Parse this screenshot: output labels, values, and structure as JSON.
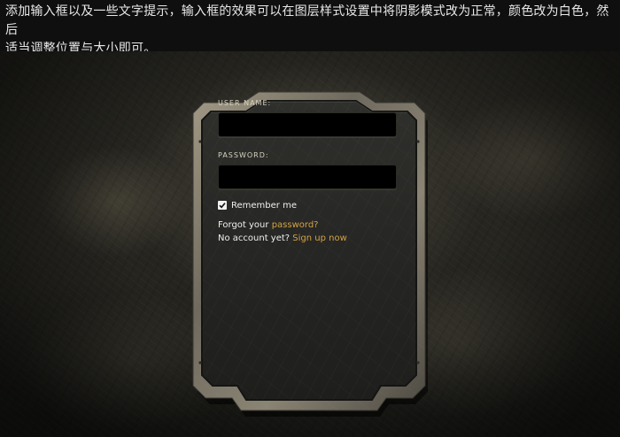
{
  "caption": {
    "line1": "添加输入框以及一些文字提示，输入框的效果可以在图层样式设置中将阴影模式改为正常，颜色改为白色，然后",
    "line2": "适当调整位置与大小即可。"
  },
  "login_form": {
    "username_label": "USER NAME:",
    "username_value": "",
    "password_label": "PASSWORD:",
    "password_value": "",
    "remember_label": "Remember me",
    "remember_checked": true,
    "forgot_prefix": "Forgot your",
    "forgot_link": "password?",
    "signup_prefix": "No account yet?",
    "signup_link": "Sign up now"
  },
  "colors": {
    "link": "#d4a344",
    "text": "#f0f0f0",
    "input_bg": "#000000"
  }
}
